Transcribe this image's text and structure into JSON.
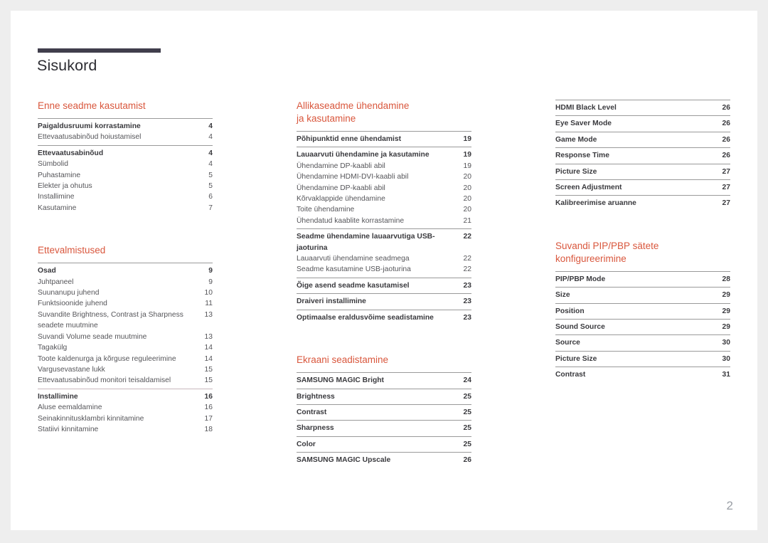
{
  "document": {
    "title": "Sisukord",
    "folio": "2",
    "accent_color": "#d9573d",
    "rule_color": "#403e4c",
    "background_color": "#eeeeee",
    "page_color": "#ffffff"
  },
  "columns": [
    {
      "name": "column-1",
      "sections": [
        {
          "heading": "Enne seadme kasutamist",
          "groups": [
            {
              "entries": [
                {
                  "label": "Paigaldusruumi korrastamine",
                  "page": "4",
                  "bold": true
                },
                {
                  "label": "Ettevaatusabinõud hoiustamisel",
                  "page": "4",
                  "bold": false
                }
              ]
            },
            {
              "entries": [
                {
                  "label": "Ettevaatusabinõud",
                  "page": "4",
                  "bold": true
                },
                {
                  "label": "Sümbolid",
                  "page": "4",
                  "bold": false
                },
                {
                  "label": "Puhastamine",
                  "page": "5",
                  "bold": false
                },
                {
                  "label": "Elekter ja ohutus",
                  "page": "5",
                  "bold": false
                },
                {
                  "label": "Installimine",
                  "page": "6",
                  "bold": false
                },
                {
                  "label": "Kasutamine",
                  "page": "7",
                  "bold": false
                }
              ]
            }
          ]
        },
        {
          "heading": "Ettevalmistused",
          "groups": [
            {
              "entries": [
                {
                  "label": "Osad",
                  "page": "9",
                  "bold": true
                },
                {
                  "label": "Juhtpaneel",
                  "page": "9",
                  "bold": false
                },
                {
                  "label": "Suunanupu juhend",
                  "page": "10",
                  "bold": false
                },
                {
                  "label": "Funktsioonide juhend",
                  "page": "11",
                  "bold": false
                },
                {
                  "label": "Suvandite Brightness, Contrast ja Sharpness seadete muutmine",
                  "page": "13",
                  "bold": false,
                  "wrap": true
                },
                {
                  "label": "Suvandi Volume seade muutmine",
                  "page": "13",
                  "bold": false
                },
                {
                  "label": "Tagakülg",
                  "page": "14",
                  "bold": false
                },
                {
                  "label": "Toote kaldenurga ja kõrguse reguleerimine",
                  "page": "14",
                  "bold": false
                },
                {
                  "label": "Vargusevastane lukk",
                  "page": "15",
                  "bold": false
                },
                {
                  "label": "Ettevaatusabinõud monitori teisaldamisel",
                  "page": "15",
                  "bold": false
                }
              ]
            },
            {
              "faint": true,
              "entries": [
                {
                  "label": "Installimine",
                  "page": "16",
                  "bold": true
                },
                {
                  "label": "Aluse eemaldamine",
                  "page": "16",
                  "bold": false
                },
                {
                  "label": "Seinakinnitusklambri kinnitamine",
                  "page": "17",
                  "bold": false
                },
                {
                  "label": "Statiivi kinnitamine",
                  "page": "18",
                  "bold": false
                }
              ]
            }
          ]
        }
      ]
    },
    {
      "name": "column-2",
      "sections": [
        {
          "heading": "Allikaseadme ühendamine\nja kasutamine",
          "groups": [
            {
              "entries": [
                {
                  "label": "Põhipunktid enne ühendamist",
                  "page": "19",
                  "bold": true
                }
              ]
            },
            {
              "entries": [
                {
                  "label": "Lauaarvuti ühendamine ja kasutamine",
                  "page": "19",
                  "bold": true
                },
                {
                  "label": "Ühendamine DP-kaabli abil",
                  "page": "19",
                  "bold": false
                },
                {
                  "label": "Ühendamine HDMI-DVI-kaabli abil",
                  "page": "20",
                  "bold": false
                },
                {
                  "label": "Ühendamine DP-kaabli abil",
                  "page": "20",
                  "bold": false
                },
                {
                  "label": "Kõrvaklappide ühendamine",
                  "page": "20",
                  "bold": false
                },
                {
                  "label": "Toite ühendamine",
                  "page": "20",
                  "bold": false
                },
                {
                  "label": "Ühendatud kaablite korrastamine",
                  "page": "21",
                  "bold": false
                }
              ]
            },
            {
              "entries": [
                {
                  "label": "Seadme ühendamine lauaarvutiga USB-jaoturina",
                  "page": "22",
                  "bold": true
                },
                {
                  "label": "Lauaarvuti ühendamine seadmega",
                  "page": "22",
                  "bold": false
                },
                {
                  "label": "Seadme kasutamine USB-jaoturina",
                  "page": "22",
                  "bold": false
                }
              ]
            },
            {
              "entries": [
                {
                  "label": "Õige asend seadme kasutamisel",
                  "page": "23",
                  "bold": true
                }
              ]
            },
            {
              "entries": [
                {
                  "label": "Draiveri installimine",
                  "page": "23",
                  "bold": true
                }
              ]
            },
            {
              "entries": [
                {
                  "label": "Optimaalse eraldusvõime seadistamine",
                  "page": "23",
                  "bold": true
                }
              ]
            }
          ]
        },
        {
          "heading": "Ekraani seadistamine",
          "groups": [
            {
              "entries": [
                {
                  "label": "SAMSUNG MAGIC Bright",
                  "page": "24",
                  "bold": true
                }
              ]
            },
            {
              "entries": [
                {
                  "label": "Brightness",
                  "page": "25",
                  "bold": true
                }
              ]
            },
            {
              "entries": [
                {
                  "label": "Contrast",
                  "page": "25",
                  "bold": true
                }
              ]
            },
            {
              "entries": [
                {
                  "label": "Sharpness",
                  "page": "25",
                  "bold": true
                }
              ]
            },
            {
              "entries": [
                {
                  "label": "Color",
                  "page": "25",
                  "bold": true
                }
              ]
            },
            {
              "entries": [
                {
                  "label": "SAMSUNG MAGIC Upscale",
                  "page": "26",
                  "bold": true
                }
              ]
            }
          ]
        }
      ]
    },
    {
      "name": "column-3",
      "sections": [
        {
          "heading": "",
          "groups": [
            {
              "entries": [
                {
                  "label": "HDMI Black Level",
                  "page": "26",
                  "bold": true
                }
              ]
            },
            {
              "entries": [
                {
                  "label": "Eye Saver Mode",
                  "page": "26",
                  "bold": true
                }
              ]
            },
            {
              "entries": [
                {
                  "label": "Game Mode",
                  "page": "26",
                  "bold": true
                }
              ]
            },
            {
              "entries": [
                {
                  "label": "Response Time",
                  "page": "26",
                  "bold": true
                }
              ]
            },
            {
              "entries": [
                {
                  "label": "Picture Size",
                  "page": "27",
                  "bold": true
                }
              ]
            },
            {
              "entries": [
                {
                  "label": "Screen Adjustment",
                  "page": "27",
                  "bold": true
                }
              ]
            },
            {
              "entries": [
                {
                  "label": "Kalibreerimise aruanne",
                  "page": "27",
                  "bold": true
                }
              ]
            }
          ]
        },
        {
          "heading": "Suvandi PIP/PBP sätete\nkonfigureerimine",
          "groups": [
            {
              "entries": [
                {
                  "label": "PIP/PBP Mode",
                  "page": "28",
                  "bold": true
                }
              ]
            },
            {
              "entries": [
                {
                  "label": "Size",
                  "page": "29",
                  "bold": true
                }
              ]
            },
            {
              "entries": [
                {
                  "label": "Position",
                  "page": "29",
                  "bold": true
                }
              ]
            },
            {
              "entries": [
                {
                  "label": "Sound Source",
                  "page": "29",
                  "bold": true
                }
              ]
            },
            {
              "entries": [
                {
                  "label": "Source",
                  "page": "30",
                  "bold": true
                }
              ]
            },
            {
              "entries": [
                {
                  "label": "Picture Size",
                  "page": "30",
                  "bold": true
                }
              ]
            },
            {
              "entries": [
                {
                  "label": "Contrast",
                  "page": "31",
                  "bold": true
                }
              ]
            }
          ]
        }
      ]
    }
  ]
}
